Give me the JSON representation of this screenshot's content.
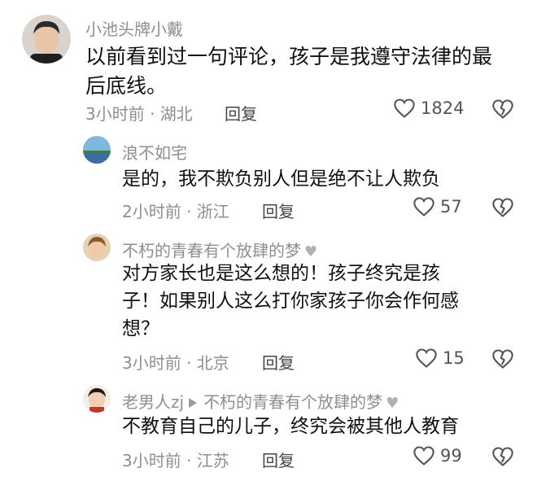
{
  "comments": [
    {
      "author": "小池头牌小戴",
      "text_lines": [
        "以前看到过一句评论，孩子是我遵守法律的最",
        "后底线。"
      ],
      "time_location": "3小时前 · 湖北",
      "reply_label": "回复",
      "likes": "1824",
      "avatar_color": "#2c2c2c"
    }
  ],
  "replies": [
    {
      "author": "浪不如宅",
      "text_lines": [
        "是的，我不欺负别人但是绝不让人欺负"
      ],
      "time_location": "2小时前 · 浙江",
      "reply_label": "回复",
      "likes": "57",
      "avatar_color": "#4a90b8"
    },
    {
      "author": "不朽的青春有个放肆的梦",
      "author_badge": "♥",
      "text_lines": [
        "对方家长也是这么想的！孩子终究是孩",
        "子！如果别人这么打你家孩子你会作何感",
        "想？"
      ],
      "time_location": "3小时前 · 北京",
      "reply_label": "回复",
      "likes": "15",
      "avatar_color": "#b8875a"
    },
    {
      "author": "老男人zj",
      "reply_to": "不朽的青春有个放肆的梦",
      "reply_to_badge": "♥",
      "text_lines": [
        "不教育自己的儿子，终究会被其他人教育"
      ],
      "time_location": "3小时前 · 江苏",
      "reply_label": "回复",
      "likes": "99",
      "avatar_color": "#c0392b"
    }
  ]
}
